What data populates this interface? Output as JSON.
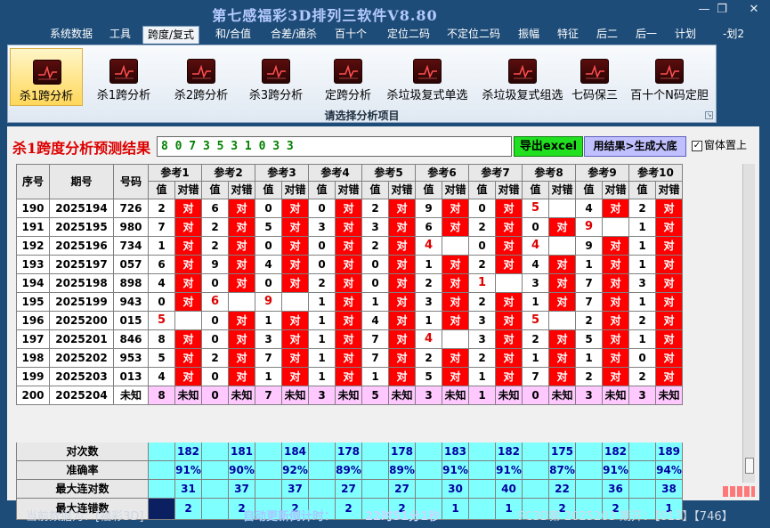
{
  "window": {
    "title": "第七感福彩3D排列三软件V8.80"
  },
  "menu": [
    "系统数据",
    "工具",
    "跨度/复式",
    "和/合值",
    "合差/通杀",
    "百十个",
    "定位二码",
    "不定位二码",
    "振幅",
    "特征",
    "后二",
    "后一",
    "计划",
    "-划2"
  ],
  "menu_active": 2,
  "ribbon": {
    "tools": [
      "杀1跨分析",
      "杀1跨分析",
      "杀2跨分析",
      "杀3跨分析",
      "定跨分析",
      "杀垃圾复式单选",
      "杀垃圾复式组选",
      "七码保三",
      "百十个N码定胆"
    ],
    "active": 0,
    "caption": "请选择分析项目"
  },
  "result": {
    "label": "杀1跨度分析预测结果",
    "value": "8 0 7 3 5 3 1 0 3 3",
    "excel_button": "导出excel",
    "gen_button": "用结果>生成大底",
    "topmost_label": "窗体置上",
    "topmost_checked": true
  },
  "table": {
    "col_seq": "序号",
    "col_issue": "期号",
    "col_num": "号码",
    "refs": [
      "参考1",
      "参考2",
      "参考3",
      "参考4",
      "参考5",
      "参考6",
      "参考7",
      "参考8",
      "参考9",
      "参考10"
    ],
    "sub_val": "值",
    "sub_hit": "对错",
    "hit_mark": "对",
    "rows": [
      {
        "seq": "190",
        "issue": "2025194",
        "num": "726",
        "vals": [
          "2",
          "6",
          "0",
          "0",
          "2",
          "9",
          "0",
          "5",
          "4",
          "2"
        ],
        "miss": [
          7
        ]
      },
      {
        "seq": "191",
        "issue": "2025195",
        "num": "980",
        "vals": [
          "7",
          "2",
          "5",
          "3",
          "3",
          "6",
          "2",
          "0",
          "9",
          "1"
        ],
        "miss": [
          8
        ]
      },
      {
        "seq": "192",
        "issue": "2025196",
        "num": "734",
        "vals": [
          "1",
          "2",
          "0",
          "0",
          "2",
          "4",
          "0",
          "4",
          "9",
          "1"
        ],
        "miss": [
          5,
          7
        ]
      },
      {
        "seq": "193",
        "issue": "2025197",
        "num": "057",
        "vals": [
          "6",
          "9",
          "4",
          "0",
          "0",
          "1",
          "2",
          "4",
          "1",
          "1"
        ],
        "miss": []
      },
      {
        "seq": "194",
        "issue": "2025198",
        "num": "898",
        "vals": [
          "4",
          "0",
          "0",
          "2",
          "0",
          "2",
          "1",
          "3",
          "7",
          "3"
        ],
        "miss": [
          6
        ]
      },
      {
        "seq": "195",
        "issue": "2025199",
        "num": "943",
        "vals": [
          "0",
          "6",
          "9",
          "1",
          "1",
          "3",
          "2",
          "1",
          "7",
          "1"
        ],
        "miss": [
          1,
          2
        ]
      },
      {
        "seq": "196",
        "issue": "2025200",
        "num": "015",
        "vals": [
          "5",
          "0",
          "1",
          "1",
          "4",
          "1",
          "3",
          "5",
          "2",
          "2"
        ],
        "miss": [
          0,
          7
        ]
      },
      {
        "seq": "197",
        "issue": "2025201",
        "num": "846",
        "vals": [
          "8",
          "0",
          "3",
          "1",
          "7",
          "4",
          "3",
          "2",
          "5",
          "1"
        ],
        "miss": [
          5
        ]
      },
      {
        "seq": "198",
        "issue": "2025202",
        "num": "953",
        "vals": [
          "5",
          "2",
          "7",
          "1",
          "7",
          "2",
          "2",
          "1",
          "1",
          "0"
        ],
        "miss": []
      },
      {
        "seq": "199",
        "issue": "2025203",
        "num": "013",
        "vals": [
          "4",
          "0",
          "1",
          "1",
          "1",
          "5",
          "1",
          "7",
          "2",
          "2"
        ],
        "miss": []
      }
    ],
    "pred_row": {
      "seq": "200",
      "issue": "2025204",
      "num": "未知",
      "vals": [
        "8",
        "0",
        "7",
        "3",
        "5",
        "3",
        "1",
        "0",
        "3",
        "3"
      ],
      "unknown": "未知"
    },
    "stats": [
      {
        "label": "对次数",
        "vals": [
          "182",
          "181",
          "184",
          "178",
          "178",
          "183",
          "182",
          "175",
          "182",
          "189"
        ]
      },
      {
        "label": "准确率",
        "vals": [
          "91%",
          "90%",
          "92%",
          "89%",
          "89%",
          "91%",
          "91%",
          "87%",
          "91%",
          "94%"
        ]
      },
      {
        "label": "最大连对数",
        "vals": [
          "31",
          "37",
          "37",
          "27",
          "27",
          "30",
          "40",
          "22",
          "36",
          "38"
        ]
      },
      {
        "label": "最大连错数",
        "vals": [
          "2",
          "2",
          "2",
          "2",
          "2",
          "1",
          "1",
          "2",
          "2",
          "1"
        ]
      }
    ]
  },
  "status": {
    "current": "当前数据为：[福彩3D]",
    "countdown_label": "自动更新倒计时：",
    "countdown": "22时51分1秒",
    "latest": "FC3D第 2025203 期开：【013】【746】"
  },
  "colors": {
    "hit": "#ff0000",
    "pred": "#ffc8ff",
    "stats": "#80ffff",
    "dark": "#0a2060",
    "header": "#e8e8e8",
    "grid_line": "#808080"
  }
}
